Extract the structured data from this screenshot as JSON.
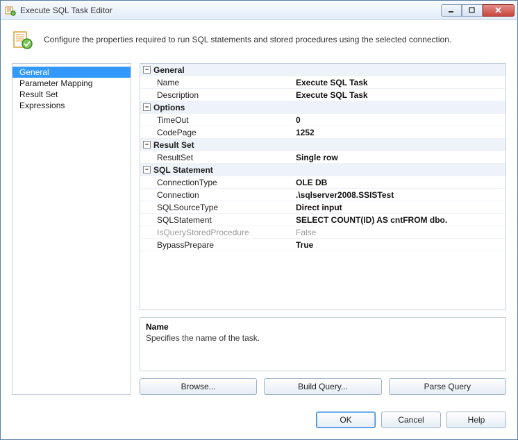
{
  "window": {
    "title": "Execute SQL Task Editor"
  },
  "header": {
    "text": "Configure the properties required to run SQL statements and stored procedures using the selected connection."
  },
  "sidebar": {
    "items": [
      {
        "label": "General",
        "selected": true
      },
      {
        "label": "Parameter Mapping",
        "selected": false
      },
      {
        "label": "Result Set",
        "selected": false
      },
      {
        "label": "Expressions",
        "selected": false
      }
    ]
  },
  "propgrid": {
    "categories": [
      {
        "label": "General",
        "rows": [
          {
            "label": "Name",
            "value": "Execute SQL Task"
          },
          {
            "label": "Description",
            "value": "Execute SQL Task"
          }
        ]
      },
      {
        "label": "Options",
        "rows": [
          {
            "label": "TimeOut",
            "value": "0"
          },
          {
            "label": "CodePage",
            "value": "1252"
          }
        ]
      },
      {
        "label": "Result Set",
        "rows": [
          {
            "label": "ResultSet",
            "value": "Single row"
          }
        ]
      },
      {
        "label": "SQL Statement",
        "rows": [
          {
            "label": "ConnectionType",
            "value": "OLE DB"
          },
          {
            "label": "Connection",
            "value": ".\\sqlserver2008.SSISTest"
          },
          {
            "label": "SQLSourceType",
            "value": "Direct input"
          },
          {
            "label": "SQLStatement",
            "value": "SELECT        COUNT(ID) AS cntFROM            dbo."
          },
          {
            "label": "IsQueryStoredProcedure",
            "value": "False",
            "disabled": true
          },
          {
            "label": "BypassPrepare",
            "value": "True"
          }
        ]
      }
    ]
  },
  "help": {
    "title": "Name",
    "desc": "Specifies the name of the task."
  },
  "buttons_row1": {
    "browse": "Browse...",
    "build": "Build Query...",
    "parse": "Parse Query"
  },
  "footer": {
    "ok": "OK",
    "cancel": "Cancel",
    "help": "Help"
  }
}
